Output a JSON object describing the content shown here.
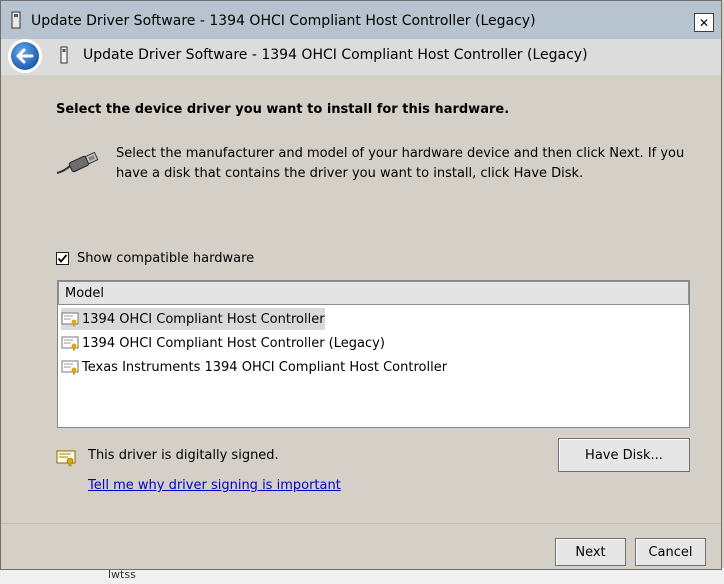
{
  "window": {
    "title": "Update Driver Software - 1394 OHCI Compliant Host Controller (Legacy)",
    "close_label": "✕"
  },
  "header": {
    "title": "Update Driver Software - 1394 OHCI Compliant Host Controller (Legacy)"
  },
  "main": {
    "instruction": "Select the device driver you want to install for this hardware.",
    "description": "Select the manufacturer and model of your hardware device and then click Next. If you have a disk that contains the driver you want to install, click Have Disk.",
    "show_compatible": {
      "label": "Show compatible hardware",
      "checked": true
    },
    "model_list": {
      "column_header": "Model",
      "items": [
        {
          "label": "1394 OHCI Compliant Host Controller",
          "selected": true
        },
        {
          "label": "1394 OHCI Compliant Host Controller (Legacy)",
          "selected": false
        },
        {
          "label": "Texas Instruments 1394 OHCI Compliant Host Controller",
          "selected": false
        }
      ]
    },
    "signature": {
      "text": "This driver is digitally signed.",
      "link": "Tell me why driver signing is important"
    },
    "have_disk_label": "Have Disk..."
  },
  "footer": {
    "next_label": "Next",
    "cancel_label": "Cancel"
  },
  "background": {
    "text": "lwtss"
  },
  "colors": {
    "window_bg": "#d4d0c8",
    "titlebar": "#b7c3ce",
    "link": "#0000cc",
    "back_button": "#1e5fb0"
  }
}
